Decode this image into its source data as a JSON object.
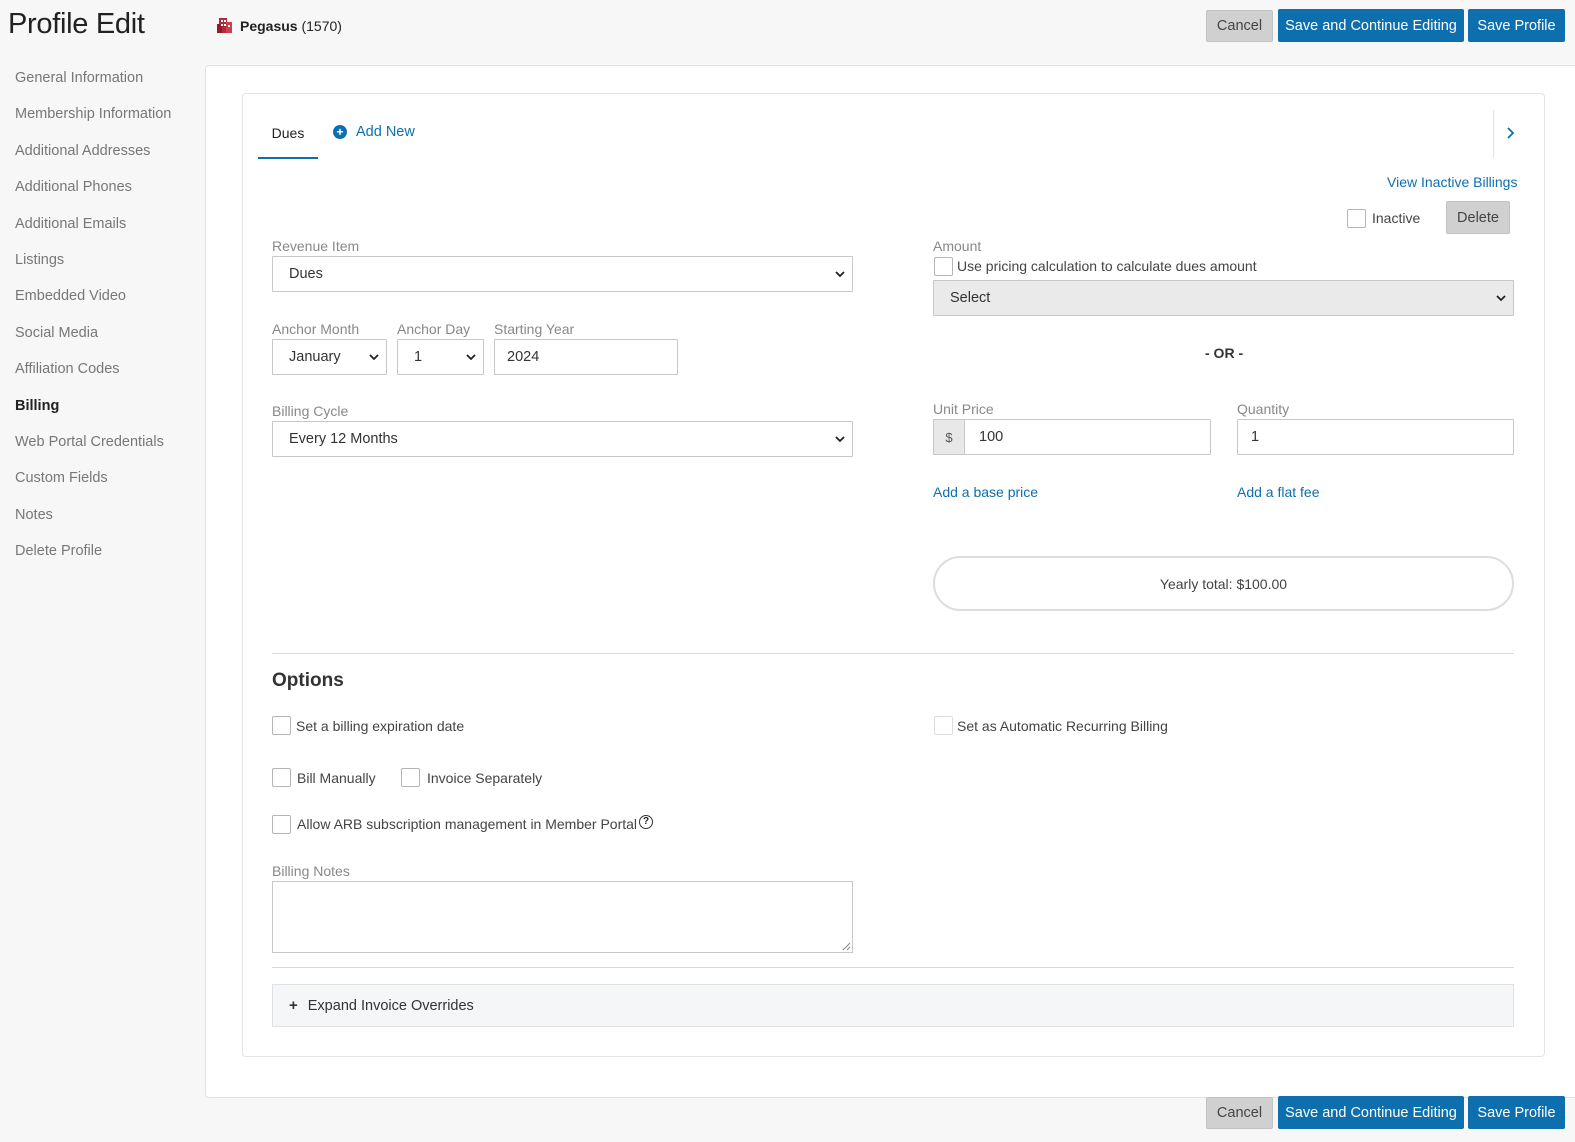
{
  "header": {
    "title": "Profile Edit",
    "org_name": "Pegasus",
    "org_id": "(1570)",
    "cancel_label": "Cancel",
    "save_continue_label": "Save and Continue Editing",
    "save_label": "Save Profile"
  },
  "sidebar": {
    "items": [
      {
        "label": "General Information"
      },
      {
        "label": "Membership Information"
      },
      {
        "label": "Additional Addresses"
      },
      {
        "label": "Additional Phones"
      },
      {
        "label": "Additional Emails"
      },
      {
        "label": "Listings"
      },
      {
        "label": "Embedded Video"
      },
      {
        "label": "Social Media"
      },
      {
        "label": "Affiliation Codes"
      },
      {
        "label": "Billing",
        "active": true
      },
      {
        "label": "Web Portal Credentials"
      },
      {
        "label": "Custom Fields"
      },
      {
        "label": "Notes"
      },
      {
        "label": "Delete Profile"
      }
    ]
  },
  "tabs": {
    "active": "Dues",
    "add_new": "Add New"
  },
  "billing": {
    "view_inactive": "View Inactive Billings",
    "inactive_label": "Inactive",
    "delete_label": "Delete",
    "revenue_item_label": "Revenue Item",
    "revenue_item_value": "Dues",
    "anchor_month_label": "Anchor Month",
    "anchor_month_value": "January",
    "anchor_day_label": "Anchor Day",
    "anchor_day_value": "1",
    "starting_year_label": "Starting Year",
    "starting_year_value": "2024",
    "billing_cycle_label": "Billing Cycle",
    "billing_cycle_value": "Every 12 Months",
    "amount_label": "Amount",
    "pricing_calc_label": "Use pricing calculation to calculate dues amount",
    "pricing_select_value": "Select",
    "or_text": "- OR -",
    "unit_price_label": "Unit Price",
    "currency_symbol": "$",
    "unit_price_value": "100",
    "quantity_label": "Quantity",
    "quantity_value": "1",
    "add_base_price": "Add a base price",
    "add_flat_fee": "Add a flat fee",
    "yearly_total": "Yearly total: $100.00"
  },
  "options": {
    "title": "Options",
    "expiration_label": "Set a billing expiration date",
    "arb_label": "Set as Automatic Recurring Billing",
    "bill_manually_label": "Bill Manually",
    "invoice_separately_label": "Invoice Separately",
    "allow_arb_label": "Allow ARB subscription management in Member Portal",
    "help_glyph": "?",
    "billing_notes_label": "Billing Notes",
    "billing_notes_value": "",
    "expand_glyph": "+",
    "expand_label": "Expand Invoice Overrides"
  },
  "colors": {
    "primary": "#0d6fad",
    "org_icon": "#b22a3a"
  }
}
